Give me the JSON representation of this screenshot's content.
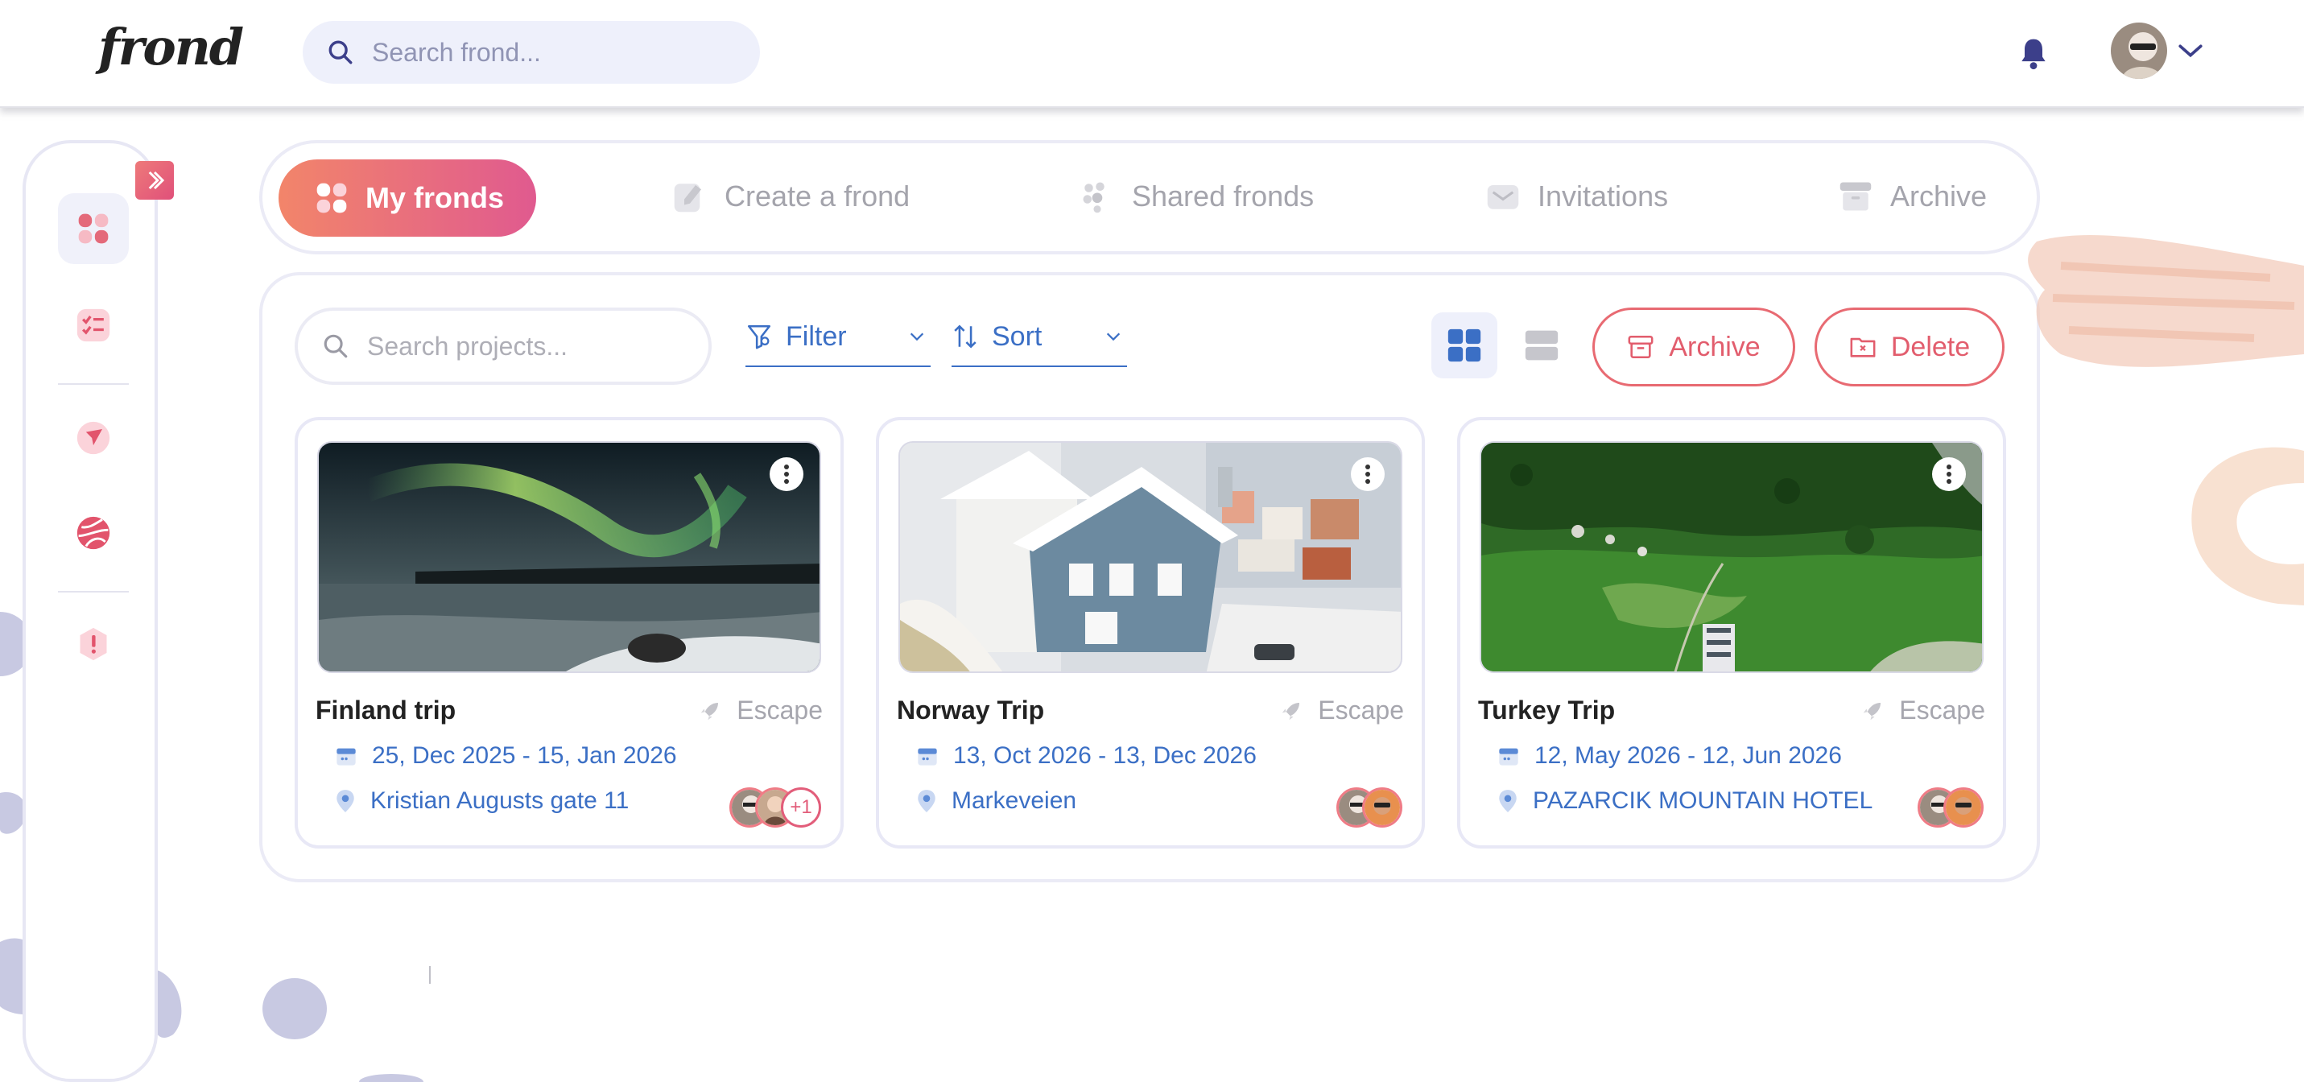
{
  "header": {
    "logo": "frond",
    "search_placeholder": "Search frond..."
  },
  "tabs": [
    {
      "label": "My fronds",
      "active": true
    },
    {
      "label": "Create a frond"
    },
    {
      "label": "Shared fronds"
    },
    {
      "label": "Invitations"
    },
    {
      "label": "Archive"
    }
  ],
  "toolbar": {
    "search_placeholder": "Search projects...",
    "filter_label": "Filter",
    "sort_label": "Sort",
    "archive_label": "Archive",
    "delete_label": "Delete"
  },
  "cards": [
    {
      "title": "Finland trip",
      "category": "Escape",
      "dates": "25, Dec 2025 - 15, Jan 2026",
      "location": "Kristian Augusts gate 11",
      "extra_members": "+1"
    },
    {
      "title": "Norway Trip",
      "category": "Escape",
      "dates": "13, Oct 2026 - 13, Dec 2026",
      "location": "Markeveien"
    },
    {
      "title": "Turkey Trip",
      "category": "Escape",
      "dates": "12, May 2026 - 12, Jun 2026",
      "location": "PAZARCIK MOUNTAIN HOTEL"
    }
  ],
  "colors": {
    "accent_gradient_start": "#f2856a",
    "accent_gradient_end": "#e05a8f",
    "link_blue": "#3b6fc5",
    "danger": "#e25d6d"
  },
  "icons": {
    "sidebar": [
      "dashboard-icon",
      "task-list-icon",
      "compass-icon",
      "globe-icon",
      "alert-icon"
    ]
  }
}
